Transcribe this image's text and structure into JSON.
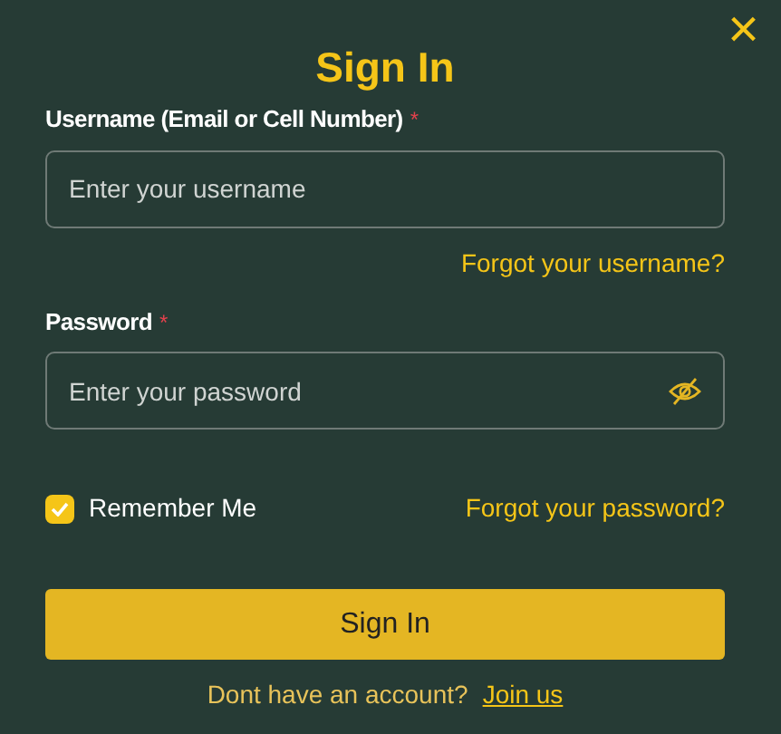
{
  "dialog": {
    "title": "Sign In",
    "close": "×"
  },
  "fields": [
    {
      "label": "Username (Email or Cell Number)",
      "required_mark": "*",
      "placeholder": "Enter your username",
      "kind": "text",
      "link": "Forgot your username?"
    },
    {
      "label": "Password",
      "required_mark": "*",
      "placeholder": "Enter your password",
      "kind": "password",
      "password_hidden": true
    }
  ],
  "remember": {
    "label": "Remember Me",
    "checked": true
  },
  "forgot_password": "Forgot your password?",
  "submit": "Sign In",
  "footer": {
    "text": "Dont have an account?",
    "link": "Join us"
  }
}
